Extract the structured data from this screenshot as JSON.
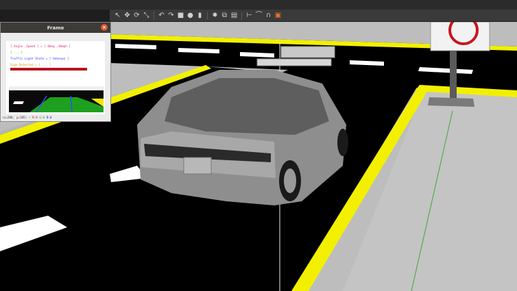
{
  "frame_window": {
    "title": "Frame",
    "close_glyph": "×",
    "info": {
      "angle_speed": "[ Angle ,Speed ] = [ 0deg ,30mph ]",
      "lanes": "[ ... ]",
      "traffic_light": "Traffic Light State = [ Unknown ]",
      "sign": "Sign Detected = [ ... ]"
    },
    "status": {
      "coords": "(x=280, y=185) ~ ",
      "r": "R:0",
      "g": "G:0",
      "b": "B:0"
    }
  },
  "toolbar": {
    "icons": [
      "cursor-icon",
      "move-icon",
      "rotate-icon",
      "scale-icon",
      "undo-icon",
      "redo-icon",
      "box-icon",
      "sphere-icon",
      "cylinder-icon",
      "light-icon",
      "copy-icon",
      "paste-icon",
      "align-icon",
      "snap-icon",
      "magnet-icon",
      "screenshot-icon"
    ],
    "glyphs": [
      "↖",
      "✥",
      "⟳",
      "⤡",
      "↶",
      "↷",
      "■",
      "●",
      "▮",
      "✹",
      "⧉",
      "▤",
      "⊢",
      "⌒",
      "∩",
      "▣"
    ],
    "accent_color": "#e8742a"
  },
  "scene": {
    "road_color": "#000000",
    "ground_color": "#c8c8c8",
    "line_color": "#f4f000",
    "dash_color": "#ffffff",
    "car_color": "#8c8c8c"
  }
}
